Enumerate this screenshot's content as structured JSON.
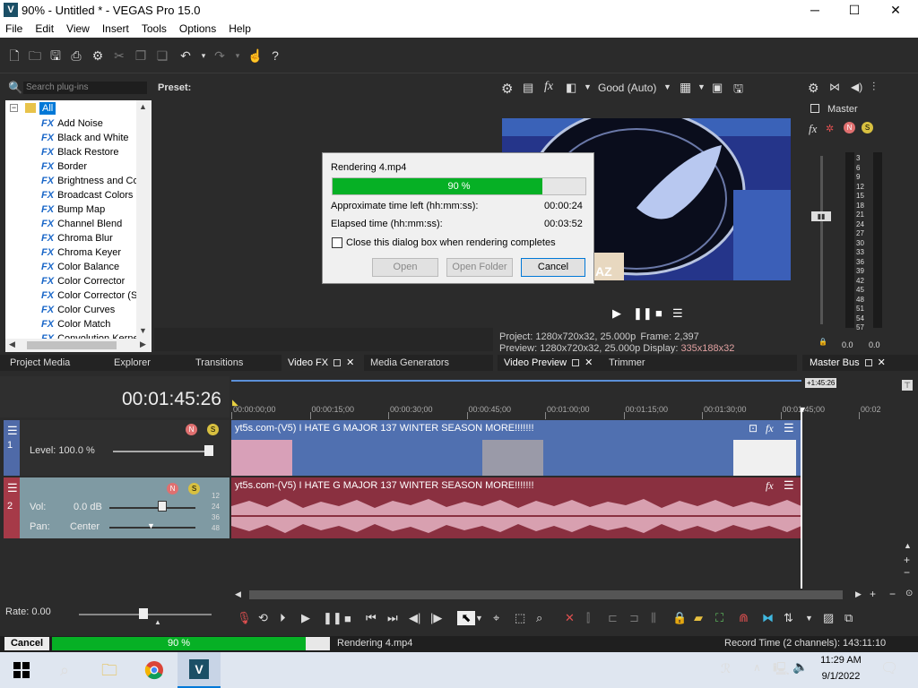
{
  "window": {
    "title": "90% - Untitled * - VEGAS Pro 15.0",
    "app_icon": "V",
    "minimize": "─",
    "maximize": "☐",
    "close": "✕"
  },
  "menu": [
    "File",
    "Edit",
    "View",
    "Insert",
    "Tools",
    "Options",
    "Help"
  ],
  "plugins": {
    "search_placeholder": "Search plug-ins",
    "preset_label": "Preset:",
    "root": "All",
    "fx_tag": "FX",
    "items": [
      "Add Noise",
      "Black and White",
      "Black Restore",
      "Border",
      "Brightness and Co",
      "Broadcast Colors",
      "Bump Map",
      "Channel Blend",
      "Chroma Blur",
      "Chroma Keyer",
      "Color Balance",
      "Color Corrector",
      "Color Corrector (S",
      "Color Curves",
      "Color Match",
      "Convolution Kerne"
    ]
  },
  "preview": {
    "quality": "Good (Auto)",
    "watermark": "AZ",
    "project_label": "Project:",
    "project_value": "1280x720x32, 25.000p",
    "frame_label": "Frame:",
    "frame_value": "2,397",
    "preview_label": "Preview:",
    "preview_value": "1280x720x32, 25.000p",
    "display_label": "Display:",
    "display_value": "335x188x32",
    "display_color": "#e0a0a0"
  },
  "master": {
    "label": "Master",
    "scale": [
      "3",
      "6",
      "9",
      "12",
      "15",
      "18",
      "21",
      "24",
      "27",
      "30",
      "33",
      "36",
      "39",
      "42",
      "45",
      "48",
      "51",
      "54",
      "57"
    ],
    "left_val": "0.0",
    "right_val": "0.0"
  },
  "tabs": {
    "left": [
      "Project Media",
      "Explorer",
      "Transitions",
      "Video FX",
      "Media Generators"
    ],
    "middle": [
      "Video Preview",
      "Trimmer"
    ],
    "right": [
      "Master Bus"
    ]
  },
  "dialog": {
    "title": "Rendering 4.mp4",
    "progress": 0.9,
    "percent": "90 %",
    "time_left_label": "Approximate time left (hh:mm:ss):",
    "time_left_value": "00:00:24",
    "elapsed_label": "Elapsed time (hh:mm:ss):",
    "elapsed_value": "00:03:52",
    "checkbox_label": "Close this dialog box when rendering completes",
    "open": "Open",
    "open_folder": "Open Folder",
    "cancel": "Cancel"
  },
  "timeline": {
    "timecode": "00:01:45:26",
    "marker": "+1:45:26",
    "ruler": [
      "00:00:00;00",
      "00:00:15;00",
      "00:00:30;00",
      "00:00:45;00",
      "00:01:00;00",
      "00:01:15;00",
      "00:01:30;00",
      "00:01:45;00",
      "00:02"
    ],
    "video_track": {
      "number": "1",
      "level_label": "Level: 100.0 %",
      "clip": "yt5s.com-(V5) I HATE G MAJOR 137 WINTER SEASON MORE!!!!!!!",
      "fx": "fx"
    },
    "audio_track": {
      "number": "2",
      "vol_label": "Vol:",
      "vol_value": "0.0 dB",
      "pan_label": "Pan:",
      "pan_value": "Center",
      "clip": "yt5s.com-(V5) I HATE G MAJOR 137 WINTER SEASON MORE!!!!!!!",
      "meter": [
        "12",
        "24",
        "36",
        "48"
      ],
      "fx": "fx"
    },
    "rate": "Rate: 0.00"
  },
  "status": {
    "cancel": "Cancel",
    "progress": 0.9,
    "percent": "90 %",
    "file": "Rendering 4.mp4",
    "record_time": "Record Time (2 channels): 143:11:10"
  },
  "taskbar": {
    "time": "11:29 AM",
    "date": "9/1/2022"
  }
}
